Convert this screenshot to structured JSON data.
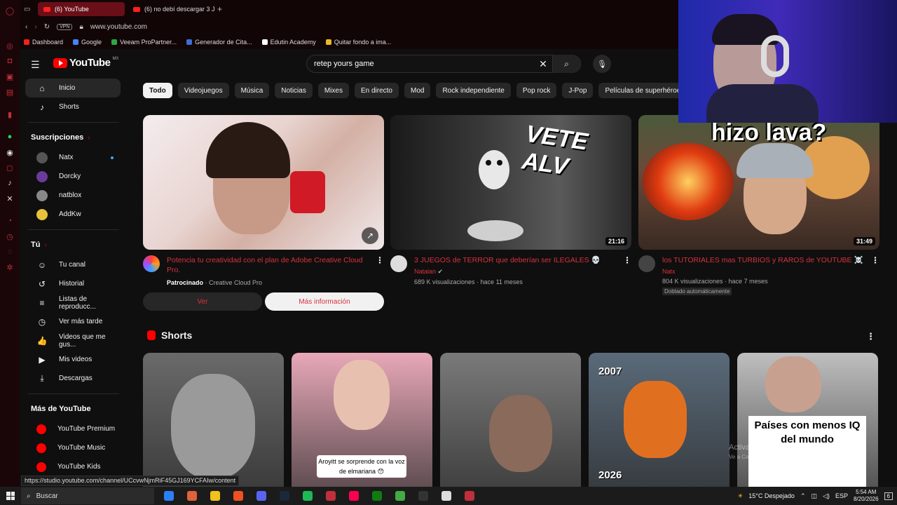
{
  "browser": {
    "tabs": [
      {
        "label": "(6) YouTube",
        "active": true
      },
      {
        "label": "(6) no debí descargar 3 JU",
        "active": false
      }
    ],
    "url": "www.youtube.com",
    "vpn_label": "VPN",
    "bookmarks": [
      {
        "label": "Dashboard",
        "color": "#e22"
      },
      {
        "label": "Google",
        "color": "#4285f4"
      },
      {
        "label": "Veeam ProPartner...",
        "color": "#2aa745"
      },
      {
        "label": "Generador de Cita...",
        "color": "#3a6fd8"
      },
      {
        "label": "Edutin Academy",
        "color": "#ffffff"
      },
      {
        "label": "Quitar fondo a ima...",
        "color": "#e8b82a"
      }
    ]
  },
  "header": {
    "logo_text": "YouTube",
    "region": "MX",
    "search_query": "retep yours game"
  },
  "nav": {
    "main": [
      {
        "label": "Inicio",
        "icon": "home-icon",
        "glyph": "⌂",
        "active": true
      },
      {
        "label": "Shorts",
        "icon": "shorts-icon",
        "glyph": "♪",
        "active": false
      }
    ],
    "subs_title": "Suscripciones",
    "subs": [
      {
        "label": "Natx",
        "color": "#555",
        "live": true
      },
      {
        "label": "Dorcky",
        "color": "#6b3b9a",
        "live": false
      },
      {
        "label": "natblox",
        "color": "#888",
        "live": false
      },
      {
        "label": "AddKw",
        "color": "#e8c23a",
        "live": false
      }
    ],
    "you_title": "Tú",
    "you": [
      {
        "label": "Tu canal",
        "icon": "channel-icon",
        "glyph": "☺"
      },
      {
        "label": "Historial",
        "icon": "history-icon",
        "glyph": "↺"
      },
      {
        "label": "Listas de reproducc...",
        "icon": "playlists-icon",
        "glyph": "≡"
      },
      {
        "label": "Ver más tarde",
        "icon": "clock-icon",
        "glyph": "◷"
      },
      {
        "label": "Videos que me gus...",
        "icon": "like-icon",
        "glyph": "👍"
      },
      {
        "label": "Mis videos",
        "icon": "video-icon",
        "glyph": "▶"
      },
      {
        "label": "Descargas",
        "icon": "download-icon",
        "glyph": "⤓"
      }
    ],
    "more_title": "Más de YouTube",
    "more": [
      {
        "label": "YouTube Premium"
      },
      {
        "label": "YouTube Music"
      },
      {
        "label": "YouTube Kids"
      }
    ]
  },
  "chips": [
    "Todo",
    "Videojuegos",
    "Música",
    "Noticias",
    "Mixes",
    "En directo",
    "Mod",
    "Rock independiente",
    "Pop rock",
    "J-Pop",
    "Películas de superhéroes",
    "J"
  ],
  "videos": [
    {
      "title": "Potencia tu creatividad con el plan de Adobe Creative Cloud Pro.",
      "sponsored": "Patrocinado",
      "channel": "Creative Cloud Pro",
      "thumb_colors": [
        "#f0e6e8",
        "#c8a094",
        "#e02030"
      ]
    },
    {
      "title": "3 JUEGOS de TERROR que deberían ser ILEGALES 💀",
      "channel": "Natalan",
      "stats": "689 K visualizaciones · hace 11 meses",
      "duration": "21:16",
      "overlay": "VETE ALV",
      "thumb_colors": [
        "#2b2b2b",
        "#6a6a6a",
        "#ffffff"
      ]
    },
    {
      "title": "los TUTORIALES mas TURBIOS y RAROS de YOUTUBE ☠️",
      "channel": "Natx",
      "stats": "804 K visualizaciones · hace 7 meses",
      "badge": "Doblado automáticamente",
      "duration": "31:49",
      "overlay": "hizo lava?",
      "thumb_colors": [
        "#5a3a2a",
        "#c43a1a",
        "#ffd060"
      ]
    }
  ],
  "ad_buttons": {
    "ver": "Ver",
    "mas": "Más información"
  },
  "shorts": {
    "title": "Shorts",
    "items": [
      {
        "bg": "#6a6a6a",
        "caption": ""
      },
      {
        "bg": "#e8a8b8",
        "caption": "Aroyitt se sorprende con la voz de elmariana 😯"
      },
      {
        "bg": "#7a7a7a",
        "caption": ""
      },
      {
        "bg": "#5a6a7a",
        "caption": "",
        "top_label": "2007",
        "bottom_label": "2026"
      },
      {
        "bg": "#bfbfbf",
        "caption": "Países con menos IQ del mundo"
      }
    ]
  },
  "status_link": "https://studio.youtube.com/channel/UCcvwNjmRiF45GJ169YCFAIw/content",
  "watermark": {
    "title": "Activar Windows",
    "sub": "Ve a Configuración para activar Windows."
  },
  "taskbar": {
    "search": "Buscar",
    "apps": [
      "#2d7ff9",
      "#e0623a",
      "#f2c21b",
      "#f25022",
      "#5865f2",
      "#1b2838",
      "#1db954",
      "#c0303a",
      "#ff0050",
      "#107c10",
      "#44aa44",
      "#333333",
      "#dddddd",
      "#c0303a"
    ],
    "weather": "15°C  Despejado",
    "lang": "ESP",
    "time": "5:54 AM",
    "date": "8/20/2026",
    "notif": "6"
  }
}
